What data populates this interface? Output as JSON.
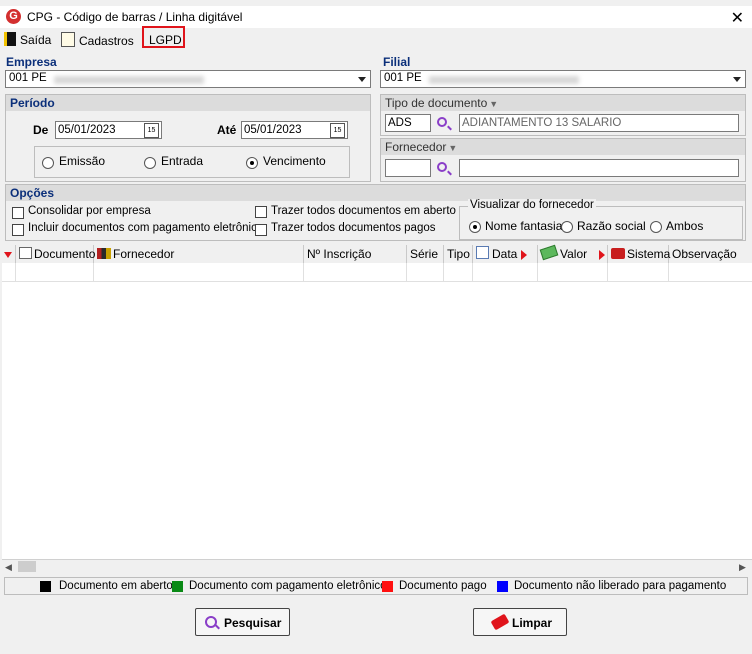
{
  "window": {
    "title": "CPG - Código de barras / Linha digitável",
    "close": "✕"
  },
  "menu": {
    "saida": "Saída",
    "cadastros": "Cadastros",
    "lgpd": "LGPD"
  },
  "empresa": {
    "label": "Empresa",
    "value": "001 PE"
  },
  "filial": {
    "label": "Filial",
    "value": "001 PE"
  },
  "periodo": {
    "label": "Período",
    "de_label": "De",
    "de_value": "05/01/2023",
    "ate_label": "Até",
    "ate_value": "05/01/2023",
    "cal_icon": "15",
    "options": [
      "Emissão",
      "Entrada",
      "Vencimento"
    ],
    "selected": "Vencimento"
  },
  "tipo_documento": {
    "label": "Tipo de documento",
    "code": "ADS",
    "desc": "ADIANTAMENTO 13 SALARIO"
  },
  "fornecedor": {
    "label": "Fornecedor",
    "code": "",
    "desc": ""
  },
  "opcoes": {
    "label": "Opções",
    "consolidar": "Consolidar por empresa",
    "incluir": "Incluir documentos com pagamento eletrônico",
    "trazer_aberto": "Trazer todos documentos em aberto",
    "trazer_pagos": "Trazer todos documentos pagos",
    "visualizar_label": "Visualizar do fornecedor",
    "visualizar_options": [
      "Nome fantasia",
      "Razão social",
      "Ambos"
    ],
    "visualizar_selected": "Nome fantasia"
  },
  "grid": {
    "columns": [
      "Documento",
      "Fornecedor",
      "Nº Inscrição",
      "Série",
      "Tipo",
      "Data",
      "Valor",
      "Sistema",
      "Observação"
    ]
  },
  "legend": [
    {
      "label": "Documento em aberto",
      "color": "#000000"
    },
    {
      "label": "Documento com pagamento eletrônico",
      "color": "#0a8a16"
    },
    {
      "label": "Documento pago",
      "color": "#ff1010"
    },
    {
      "label": "Documento não liberado para pagamento",
      "color": "#0000ff"
    }
  ],
  "buttons": {
    "pesquisar": "Pesquisar",
    "limpar": "Limpar"
  }
}
